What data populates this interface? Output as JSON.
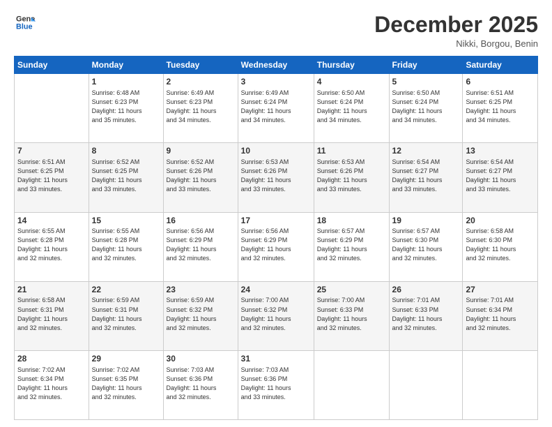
{
  "logo": {
    "line1": "General",
    "line2": "Blue"
  },
  "header": {
    "month": "December 2025",
    "location": "Nikki, Borgou, Benin"
  },
  "weekdays": [
    "Sunday",
    "Monday",
    "Tuesday",
    "Wednesday",
    "Thursday",
    "Friday",
    "Saturday"
  ],
  "weeks": [
    [
      {
        "day": "",
        "info": ""
      },
      {
        "day": "1",
        "info": "Sunrise: 6:48 AM\nSunset: 6:23 PM\nDaylight: 11 hours\nand 35 minutes."
      },
      {
        "day": "2",
        "info": "Sunrise: 6:49 AM\nSunset: 6:23 PM\nDaylight: 11 hours\nand 34 minutes."
      },
      {
        "day": "3",
        "info": "Sunrise: 6:49 AM\nSunset: 6:24 PM\nDaylight: 11 hours\nand 34 minutes."
      },
      {
        "day": "4",
        "info": "Sunrise: 6:50 AM\nSunset: 6:24 PM\nDaylight: 11 hours\nand 34 minutes."
      },
      {
        "day": "5",
        "info": "Sunrise: 6:50 AM\nSunset: 6:24 PM\nDaylight: 11 hours\nand 34 minutes."
      },
      {
        "day": "6",
        "info": "Sunrise: 6:51 AM\nSunset: 6:25 PM\nDaylight: 11 hours\nand 34 minutes."
      }
    ],
    [
      {
        "day": "7",
        "info": "Sunrise: 6:51 AM\nSunset: 6:25 PM\nDaylight: 11 hours\nand 33 minutes."
      },
      {
        "day": "8",
        "info": "Sunrise: 6:52 AM\nSunset: 6:25 PM\nDaylight: 11 hours\nand 33 minutes."
      },
      {
        "day": "9",
        "info": "Sunrise: 6:52 AM\nSunset: 6:26 PM\nDaylight: 11 hours\nand 33 minutes."
      },
      {
        "day": "10",
        "info": "Sunrise: 6:53 AM\nSunset: 6:26 PM\nDaylight: 11 hours\nand 33 minutes."
      },
      {
        "day": "11",
        "info": "Sunrise: 6:53 AM\nSunset: 6:26 PM\nDaylight: 11 hours\nand 33 minutes."
      },
      {
        "day": "12",
        "info": "Sunrise: 6:54 AM\nSunset: 6:27 PM\nDaylight: 11 hours\nand 33 minutes."
      },
      {
        "day": "13",
        "info": "Sunrise: 6:54 AM\nSunset: 6:27 PM\nDaylight: 11 hours\nand 33 minutes."
      }
    ],
    [
      {
        "day": "14",
        "info": "Sunrise: 6:55 AM\nSunset: 6:28 PM\nDaylight: 11 hours\nand 32 minutes."
      },
      {
        "day": "15",
        "info": "Sunrise: 6:55 AM\nSunset: 6:28 PM\nDaylight: 11 hours\nand 32 minutes."
      },
      {
        "day": "16",
        "info": "Sunrise: 6:56 AM\nSunset: 6:29 PM\nDaylight: 11 hours\nand 32 minutes."
      },
      {
        "day": "17",
        "info": "Sunrise: 6:56 AM\nSunset: 6:29 PM\nDaylight: 11 hours\nand 32 minutes."
      },
      {
        "day": "18",
        "info": "Sunrise: 6:57 AM\nSunset: 6:29 PM\nDaylight: 11 hours\nand 32 minutes."
      },
      {
        "day": "19",
        "info": "Sunrise: 6:57 AM\nSunset: 6:30 PM\nDaylight: 11 hours\nand 32 minutes."
      },
      {
        "day": "20",
        "info": "Sunrise: 6:58 AM\nSunset: 6:30 PM\nDaylight: 11 hours\nand 32 minutes."
      }
    ],
    [
      {
        "day": "21",
        "info": "Sunrise: 6:58 AM\nSunset: 6:31 PM\nDaylight: 11 hours\nand 32 minutes."
      },
      {
        "day": "22",
        "info": "Sunrise: 6:59 AM\nSunset: 6:31 PM\nDaylight: 11 hours\nand 32 minutes."
      },
      {
        "day": "23",
        "info": "Sunrise: 6:59 AM\nSunset: 6:32 PM\nDaylight: 11 hours\nand 32 minutes."
      },
      {
        "day": "24",
        "info": "Sunrise: 7:00 AM\nSunset: 6:32 PM\nDaylight: 11 hours\nand 32 minutes."
      },
      {
        "day": "25",
        "info": "Sunrise: 7:00 AM\nSunset: 6:33 PM\nDaylight: 11 hours\nand 32 minutes."
      },
      {
        "day": "26",
        "info": "Sunrise: 7:01 AM\nSunset: 6:33 PM\nDaylight: 11 hours\nand 32 minutes."
      },
      {
        "day": "27",
        "info": "Sunrise: 7:01 AM\nSunset: 6:34 PM\nDaylight: 11 hours\nand 32 minutes."
      }
    ],
    [
      {
        "day": "28",
        "info": "Sunrise: 7:02 AM\nSunset: 6:34 PM\nDaylight: 11 hours\nand 32 minutes."
      },
      {
        "day": "29",
        "info": "Sunrise: 7:02 AM\nSunset: 6:35 PM\nDaylight: 11 hours\nand 32 minutes."
      },
      {
        "day": "30",
        "info": "Sunrise: 7:03 AM\nSunset: 6:36 PM\nDaylight: 11 hours\nand 32 minutes."
      },
      {
        "day": "31",
        "info": "Sunrise: 7:03 AM\nSunset: 6:36 PM\nDaylight: 11 hours\nand 33 minutes."
      },
      {
        "day": "",
        "info": ""
      },
      {
        "day": "",
        "info": ""
      },
      {
        "day": "",
        "info": ""
      }
    ]
  ]
}
